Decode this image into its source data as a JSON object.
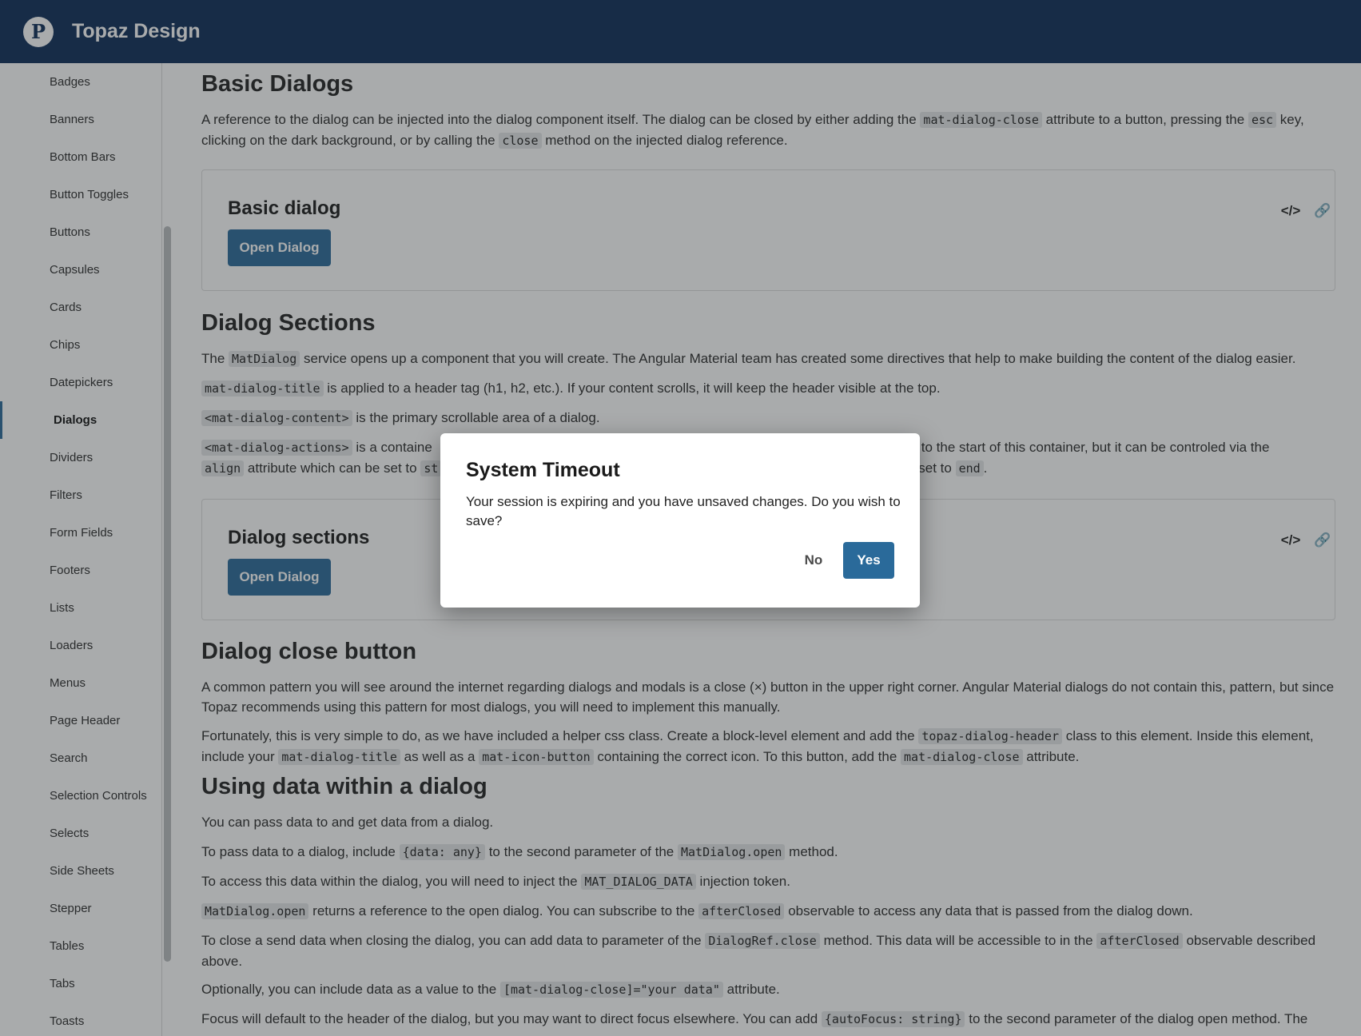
{
  "app": {
    "title": "Topaz Design",
    "logo_letter": "P"
  },
  "sidebar": {
    "items": [
      {
        "label": "Badges"
      },
      {
        "label": "Banners"
      },
      {
        "label": "Bottom Bars"
      },
      {
        "label": "Button Toggles"
      },
      {
        "label": "Buttons"
      },
      {
        "label": "Capsules"
      },
      {
        "label": "Cards"
      },
      {
        "label": "Chips"
      },
      {
        "label": "Datepickers"
      },
      {
        "label": "Dialogs"
      },
      {
        "label": "Dividers"
      },
      {
        "label": "Filters"
      },
      {
        "label": "Form Fields"
      },
      {
        "label": "Footers"
      },
      {
        "label": "Lists"
      },
      {
        "label": "Loaders"
      },
      {
        "label": "Menus"
      },
      {
        "label": "Page Header"
      },
      {
        "label": "Search"
      },
      {
        "label": "Selection Controls"
      },
      {
        "label": "Selects"
      },
      {
        "label": "Side Sheets"
      },
      {
        "label": "Stepper"
      },
      {
        "label": "Tables"
      },
      {
        "label": "Tabs"
      },
      {
        "label": "Toasts"
      }
    ],
    "active": "Dialogs"
  },
  "main": {
    "basic": {
      "heading": "Basic Dialogs",
      "p1_a": "A reference to the dialog can be injected into the dialog component itself. The dialog can be closed by either adding the",
      "p1_code1": "mat-dialog-close",
      "p1_b": "attribute to a button, pressing the",
      "p1_code2": "esc",
      "p1_c": "key, clicking on the dark background, or by calling the",
      "p1_code3": "close",
      "p1_d": "method on the injected dialog reference.",
      "example_title": "Basic dialog",
      "button": "Open Dialog"
    },
    "sections": {
      "heading": "Dialog Sections",
      "p1_a": "The",
      "p1_code": "MatDialog",
      "p1_b": "service opens up a component that you will create. The Angular Material team has created some directives that help to make building the content of the dialog easier.",
      "p2_code": "mat-dialog-title",
      "p2_text": "is applied to a header tag (h1, h2, etc.). If your content scrolls, it will keep the header visible at the top.",
      "p3_code": "<mat-dialog-content>",
      "p3_text": "is the primary scrollable area of a dialog.",
      "p4_code": "<mat-dialog-actions>",
      "p4_a": "is a containe",
      "p4_b": "will be to the start of this container, but it can be controled via the",
      "p4_code2": "align",
      "p4_c": "attribute which can be set to",
      "p4_code3": "st",
      "p4_d": "alue set to",
      "p4_code4": "end",
      "p4_e": ".",
      "example_title": "Dialog sections",
      "button": "Open Dialog"
    },
    "close": {
      "heading": "Dialog close button",
      "p1": "A common pattern you will see around the internet regarding dialogs and modals is a close (×) button in the upper right corner. Angular Material dialogs do not contain this, pattern, but since Topaz recommends using this pattern for most dialogs, you will need to implement this manually.",
      "p2_a": "Fortunately, this is very simple to do, as we have included a helper css class. Create a block-level element and add the",
      "p2_code1": "topaz-dialog-header",
      "p2_b": "class to this element. Inside this element, include your",
      "p2_code2": "mat-dialog-title",
      "p2_c": "as well as a",
      "p2_code3": "mat-icon-button",
      "p2_d": "containing the correct icon. To this button, add the",
      "p2_code4": "mat-dialog-close",
      "p2_e": "attribute."
    },
    "data": {
      "heading": "Using data within a dialog",
      "p1": "You can pass data to and get data from a dialog.",
      "p2_a": "To pass data to a dialog, include",
      "p2_code1": "{data: any}",
      "p2_b": "to the second parameter of the",
      "p2_code2": "MatDialog.open",
      "p2_c": "method.",
      "p3_a": "To access this data within the dialog, you will need to inject the",
      "p3_code": "MAT_DIALOG_DATA",
      "p3_b": "injection token.",
      "p4_code1": "MatDialog.open",
      "p4_a": "returns a reference to the open dialog. You can subscribe to the",
      "p4_code2": "afterClosed",
      "p4_b": "observable to access any data that is passed from the dialog down.",
      "p5_a": "To close a send data when closing the dialog, you can add data to parameter of the",
      "p5_code1": "DialogRef.close",
      "p5_b": "method. This data will be accessible to in the",
      "p5_code2": "afterClosed",
      "p5_c": "observable described above.",
      "p6_a": "Optionally, you can include data as a value to the",
      "p6_code": "[mat-dialog-close]=\"your data\"",
      "p6_b": "attribute.",
      "p7_a": "Focus will default to the header of the dialog, but you may want to direct focus elsewhere. You can add",
      "p7_code": "{autoFocus: string}",
      "p7_b": "to the second parameter of the dialog open method. The"
    }
  },
  "dialog": {
    "title": "System Timeout",
    "body": "Your session is expiring and you have unsaved changes. Do you wish to save?",
    "no_label": "No",
    "yes_label": "Yes"
  },
  "icons": {
    "code": "code-icon",
    "link": "link-icon",
    "logo": "pluralsight-logo-icon"
  },
  "colors": {
    "header": "#0c2c57",
    "primary": "#2a6a9a",
    "overlay": "rgba(40,44,48,0.40)"
  }
}
